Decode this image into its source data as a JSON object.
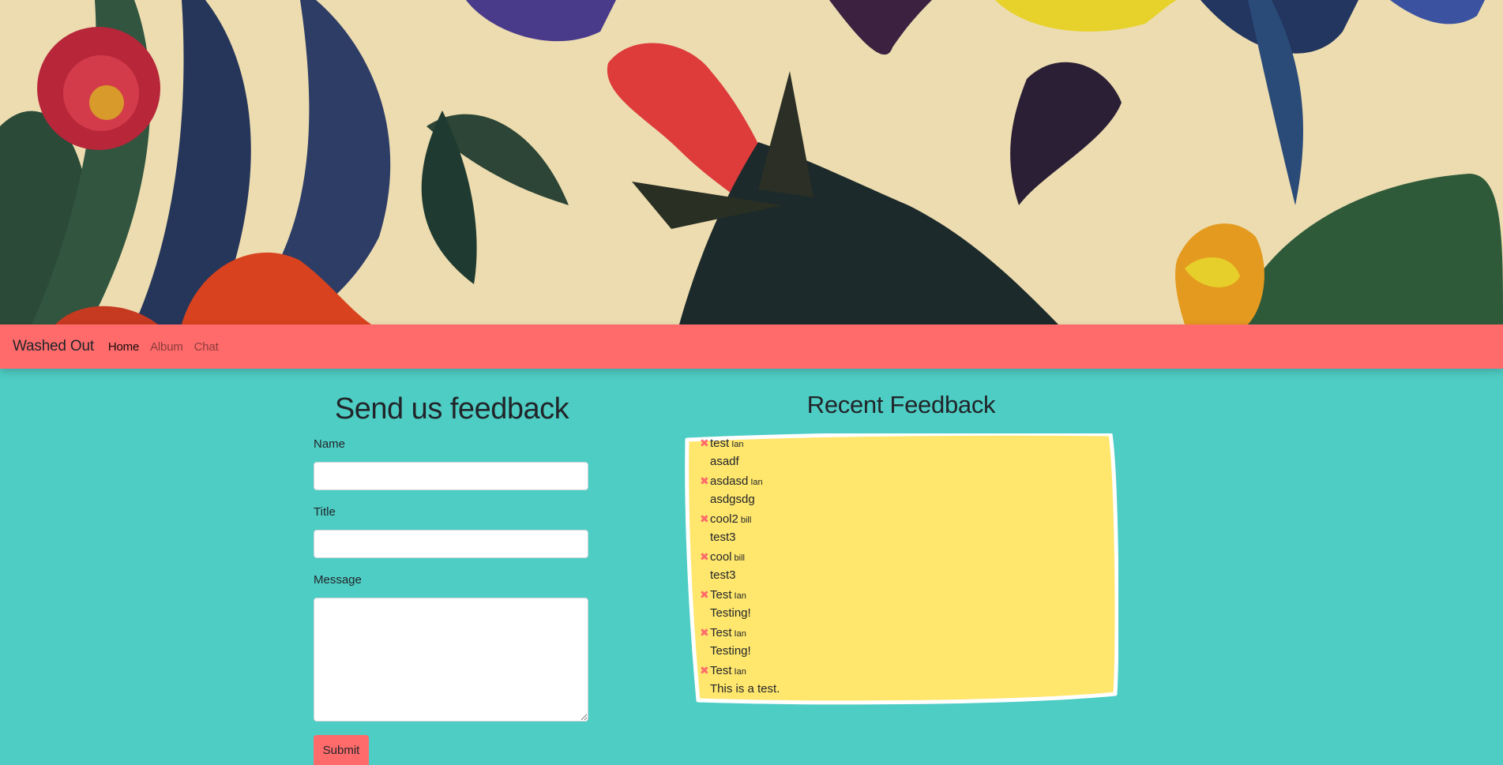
{
  "hero": {
    "alt": "botanical birds and flowers illustration"
  },
  "nav": {
    "brand": "Washed Out",
    "links": [
      {
        "label": "Home",
        "active": true
      },
      {
        "label": "Album",
        "active": false
      },
      {
        "label": "Chat",
        "active": false
      }
    ]
  },
  "form": {
    "title": "Send us feedback",
    "name_label": "Name",
    "name_value": "",
    "title_label": "Title",
    "title_value": "",
    "message_label": "Message",
    "message_value": "",
    "submit_label": "Submit"
  },
  "feedback": {
    "title": "Recent Feedback",
    "items": [
      {
        "title": "test",
        "author": "Ian",
        "message": "asadf"
      },
      {
        "title": "asdasd",
        "author": "Ian",
        "message": "asdgsdg"
      },
      {
        "title": "cool2",
        "author": "bill",
        "message": "test3"
      },
      {
        "title": "cool",
        "author": "bill",
        "message": "test3"
      },
      {
        "title": "Test",
        "author": "Ian",
        "message": "Testing!"
      },
      {
        "title": "Test",
        "author": "Ian",
        "message": "Testing!"
      },
      {
        "title": "Test",
        "author": "Ian",
        "message": "This is a test."
      }
    ],
    "delete_icon": "close-icon"
  },
  "colors": {
    "accent": "#ff6b6b",
    "background": "#4ecdc4",
    "feedback_bg": "#ffe66d",
    "hero_bg": "#ecdcb0"
  }
}
